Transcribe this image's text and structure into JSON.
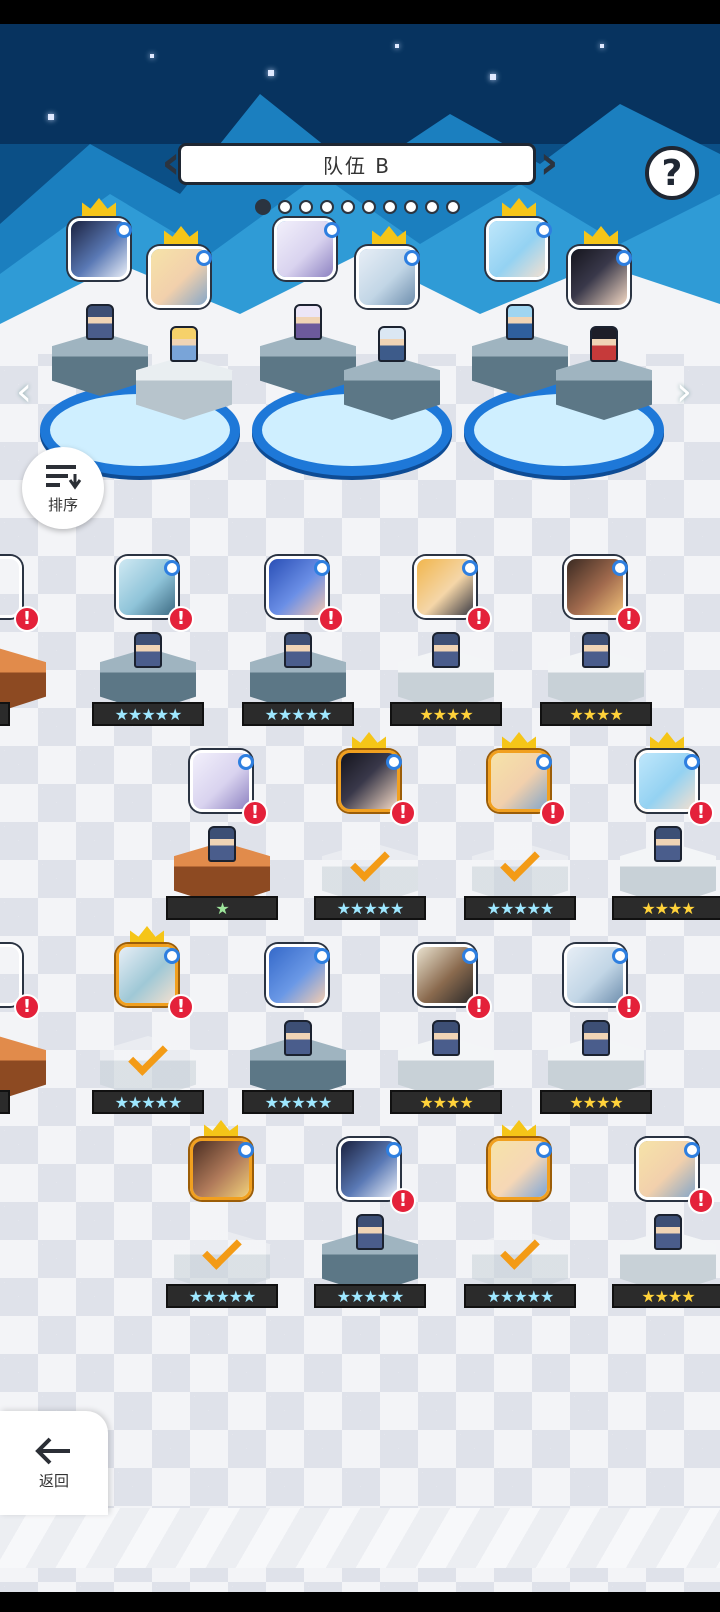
{
  "team": {
    "name": "队伍 B",
    "page_count": 10,
    "active_page": 1
  },
  "buttons": {
    "help": "?",
    "sort_label": "排序",
    "back_label": "返回"
  },
  "colors": {
    "accent_gold": "#f1a01f",
    "alert_red": "#e4213a",
    "ring_blue": "#1e78d8"
  },
  "roster": [
    {
      "row": 1,
      "stars": "★★★★★",
      "type": "rainbow",
      "selected": false,
      "alert": true
    },
    {
      "row": 1,
      "stars": "★★★★★",
      "type": "rainbow",
      "selected": false,
      "alert": true
    },
    {
      "row": 1,
      "stars": "★★★★",
      "type": "gold",
      "selected": false,
      "alert": true
    },
    {
      "row": 1,
      "stars": "★★★★",
      "type": "gold",
      "selected": false,
      "alert": true
    },
    {
      "row": 2,
      "stars": "★",
      "type": "green",
      "selected": false,
      "alert": true
    },
    {
      "row": 2,
      "stars": "★★★★★",
      "type": "rainbow",
      "selected": true,
      "alert": true
    },
    {
      "row": 2,
      "stars": "★★★★★",
      "type": "rainbow",
      "selected": true,
      "alert": true
    },
    {
      "row": 2,
      "stars": "★★★★",
      "type": "gold",
      "selected": true,
      "alert": false
    },
    {
      "row": 2,
      "stars": "★★★★",
      "type": "gold",
      "selected": false,
      "alert": true
    },
    {
      "row": 3,
      "stars": "★★★★★",
      "type": "rainbow",
      "selected": true,
      "alert": true
    },
    {
      "row": 3,
      "stars": "★★★★★",
      "type": "rainbow",
      "selected": false,
      "alert": false
    },
    {
      "row": 3,
      "stars": "★★★★",
      "type": "gold",
      "selected": false,
      "alert": true
    },
    {
      "row": 3,
      "stars": "★★★★",
      "type": "gold",
      "selected": false,
      "alert": true
    },
    {
      "row": 4,
      "stars": "★★★★★",
      "type": "rainbow",
      "selected": true,
      "alert": false
    },
    {
      "row": 4,
      "stars": "★★★★★",
      "type": "rainbow",
      "selected": false,
      "alert": true
    },
    {
      "row": 4,
      "stars": "★★★★★",
      "type": "rainbow",
      "selected": true,
      "alert": false
    },
    {
      "row": 4,
      "stars": "★★★★",
      "type": "gold",
      "selected": false,
      "alert": true
    },
    {
      "row": 4,
      "stars": "★★★★",
      "type": "gold",
      "selected": false,
      "alert": true
    }
  ],
  "partial": {
    "star_single": "★",
    "alert_mark": "!"
  }
}
